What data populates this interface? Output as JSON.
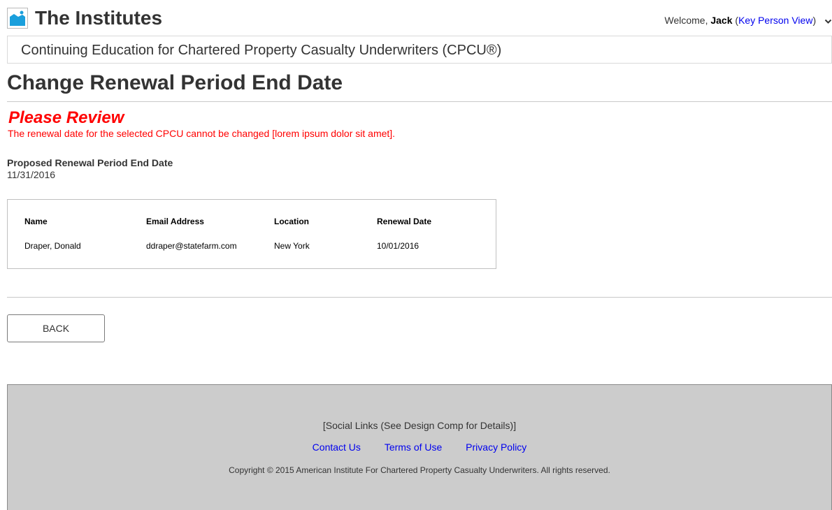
{
  "header": {
    "site_title": "The Institutes",
    "welcome_prefix": "Welcome,",
    "user_name": "Jack",
    "view_link": "Key Person View",
    "open_paren": "(",
    "close_paren": ")",
    "logo_icon": "image-icon",
    "menu_icon": "chevron-down-icon"
  },
  "program": {
    "title": "Continuing Education for Chartered Property Casualty Underwriters (CPCU®)"
  },
  "page": {
    "title": "Change Renewal Period End Date"
  },
  "review": {
    "heading": "Please Review",
    "message": "The renewal date for the selected CPCU cannot be changed [lorem ipsum dolor sit amet]."
  },
  "proposed": {
    "label": "Proposed Renewal Period End Date",
    "value": "11/31/2016"
  },
  "table": {
    "headers": [
      "Name",
      "Email Address",
      "Location",
      "Renewal Date"
    ],
    "rows": [
      [
        "Draper, Donald",
        "ddraper@statefarm.com",
        "New York",
        "10/01/2016"
      ]
    ]
  },
  "actions": {
    "back_label": "BACK"
  },
  "footer": {
    "social_text": "[Social Links (See Design Comp for Details)]",
    "links": [
      "Contact Us",
      "Terms of Use",
      "Privacy Policy"
    ],
    "copyright": "Copyright © 2015 American Institute For Chartered Property Casualty Underwriters. All rights reserved."
  },
  "colors": {
    "alert": "#ff0000",
    "link": "#0000ee",
    "footer_bg": "#cccccc",
    "logo_blue": "#1a9fdc"
  }
}
